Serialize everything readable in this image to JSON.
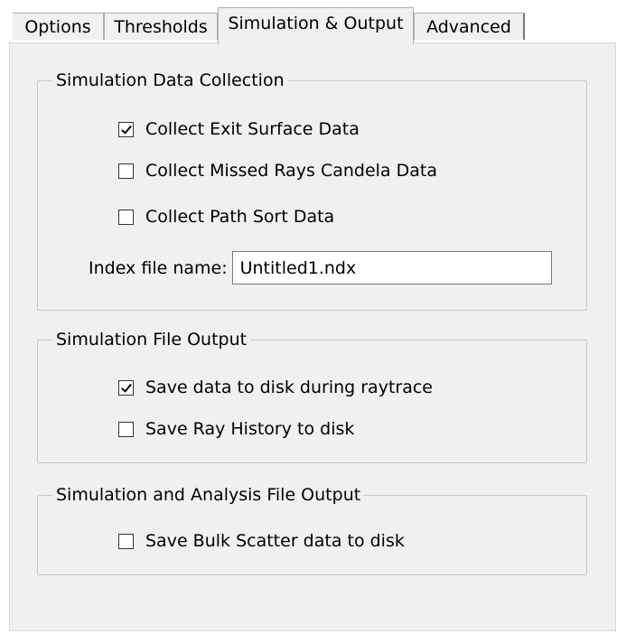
{
  "tabs": [
    {
      "label": "Options",
      "active": false
    },
    {
      "label": "Thresholds",
      "active": false
    },
    {
      "label": "Simulation & Output",
      "active": true
    },
    {
      "label": "Advanced",
      "active": false
    }
  ],
  "collection": {
    "title": "Simulation Data Collection",
    "exit_surface": {
      "label": "Collect Exit Surface Data",
      "checked": true
    },
    "missed_rays": {
      "label": "Collect Missed Rays Candela Data",
      "checked": false
    },
    "path_sort": {
      "label": "Collect Path Sort Data",
      "checked": false
    },
    "index_label": "Index file name:",
    "index_value": "Untitled1.ndx"
  },
  "file_output": {
    "title": "Simulation File Output",
    "save_during_raytrace": {
      "label": "Save data to disk during raytrace",
      "checked": true
    },
    "save_ray_history": {
      "label": "Save Ray History to disk",
      "checked": false
    }
  },
  "analysis_output": {
    "title": "Simulation and Analysis File Output",
    "save_bulk_scatter": {
      "label": "Save Bulk Scatter data to disk",
      "checked": false
    }
  }
}
